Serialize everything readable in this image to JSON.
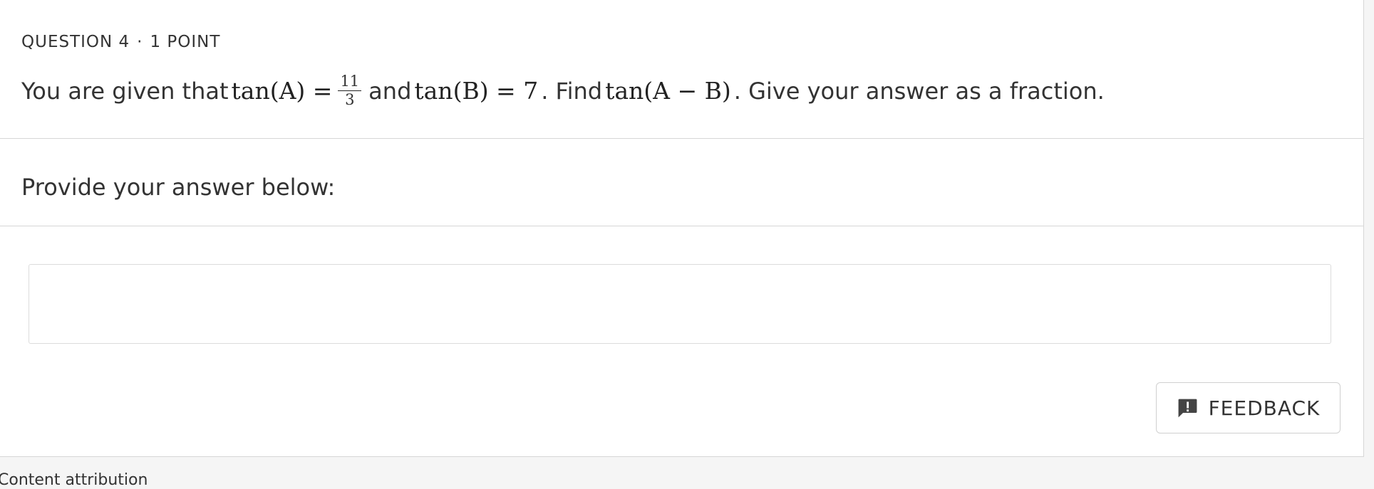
{
  "question": {
    "label": "QUESTION 4",
    "separator": "·",
    "points": "1 POINT",
    "text_before": "You are given that",
    "expr_a": "tan(A) =",
    "frac_num": "11",
    "frac_den": "3",
    "text_and": "and",
    "expr_b": "tan(B) = 7",
    "text_find": ". Find",
    "expr_c": "tan(A − B)",
    "text_after": ". Give your answer as a fraction."
  },
  "answer": {
    "prompt": "Provide your answer below:",
    "value": "",
    "placeholder": ""
  },
  "feedback": {
    "label": "FEEDBACK",
    "icon": "feedback-icon"
  },
  "footer": {
    "attribution": "Content attribution"
  }
}
